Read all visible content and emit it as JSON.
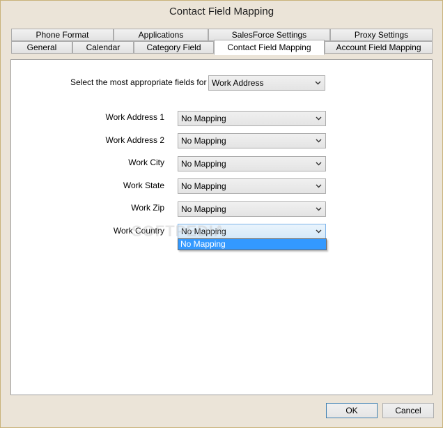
{
  "window": {
    "title": "Contact Field Mapping"
  },
  "tabs_back": [
    "Phone Format",
    "Applications",
    "SalesForce Settings",
    "Proxy Settings"
  ],
  "tabs_front": [
    "General",
    "Calendar",
    "Category Field",
    "Contact Field Mapping",
    "Account Field Mapping"
  ],
  "active_tab": "Contact Field Mapping",
  "selector": {
    "label": "Select the most appropriate fields for",
    "value": "Work Address"
  },
  "fields": [
    {
      "label": "Work Address 1",
      "value": "No Mapping"
    },
    {
      "label": "Work Address 2",
      "value": "No Mapping"
    },
    {
      "label": "Work City",
      "value": "No Mapping"
    },
    {
      "label": "Work State",
      "value": "No Mapping"
    },
    {
      "label": "Work Zip",
      "value": "No Mapping"
    },
    {
      "label": "Work Country",
      "value": "No Mapping"
    }
  ],
  "dropdown": {
    "options": [
      "No Mapping"
    ]
  },
  "watermark": "SOFTPEDIA",
  "buttons": {
    "ok": "OK",
    "cancel": "Cancel"
  },
  "colors": {
    "selection": "#3399ff",
    "frame": "#ebe4d8"
  }
}
